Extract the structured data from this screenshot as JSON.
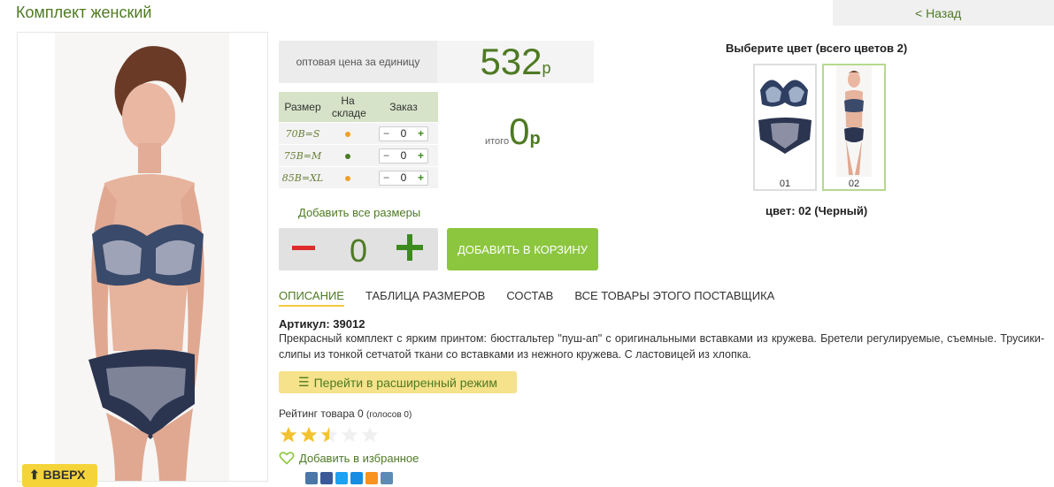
{
  "header": {
    "title": "Комплект женский",
    "back_label": "< Назад"
  },
  "product": {
    "up_button": "ВВЕРХ"
  },
  "price": {
    "label": "оптовая цена за единицу",
    "value": "532",
    "currency": "р"
  },
  "sizes_table": {
    "headers": [
      "Размер",
      "На складе",
      "Заказ"
    ],
    "rows": [
      {
        "size": "70B=S",
        "stock_color": "#f0a028",
        "qty": "0"
      },
      {
        "size": "75B=M",
        "stock_color": "#4a7a25",
        "qty": "0"
      },
      {
        "size": "85B=XL",
        "stock_color": "#f0a028",
        "qty": "0"
      }
    ]
  },
  "total": {
    "label": "итого",
    "value": "0",
    "currency": "р"
  },
  "add_all_sizes": "Добавить все размеры",
  "quantity": {
    "minus": "−",
    "value": "0",
    "plus": "+"
  },
  "cart_button": "ДОБАВИТЬ В КОРЗИНУ",
  "tabs": [
    {
      "label": "ОПИСАНИЕ"
    },
    {
      "label": "ТАБЛИЦА РАЗМЕРОВ"
    },
    {
      "label": "СОСТАВ"
    },
    {
      "label": "ВСЕ ТОВАРЫ ЭТОГО ПОСТАВЩИКА"
    }
  ],
  "description": {
    "article": "Артикул: 39012",
    "text": "Прекрасный комплект с ярким принтом: бюстгальтер \"пуш-ап\" с оригинальными вставками из кружева. Бретели регулируемые, съемные. Трусики-слипы из тонкой сетчатой ткани со вставками из нежного кружева. С ластовицей из хлопка."
  },
  "extended_mode_button": "Перейти в расширенный режим",
  "rating": {
    "label": "Рейтинг товара 0",
    "votes": "(голосов 0)",
    "stars_filled": 2.5,
    "stars_total": 5
  },
  "favorite": "Добавить в избранное",
  "colors": {
    "title": "Выберите цвет (всего цветов 2)",
    "items": [
      {
        "number": "01"
      },
      {
        "number": "02"
      }
    ],
    "current": "цвет: 02 (Черный)"
  },
  "social_icons": [
    {
      "name": "vk-icon",
      "color": "#4a76a8"
    },
    {
      "name": "facebook-icon",
      "color": "#3b5998"
    },
    {
      "name": "twitter-icon",
      "color": "#1da1f2"
    },
    {
      "name": "mailru-icon",
      "color": "#168de2"
    },
    {
      "name": "odnoklassniki-icon",
      "color": "#f7931e"
    },
    {
      "name": "livejournal-icon",
      "color": "#5c8cb5"
    }
  ],
  "colors_theme": {
    "accent": "#4e7a23",
    "button_green": "#8cc63f",
    "minus_red": "#e02b2b"
  }
}
